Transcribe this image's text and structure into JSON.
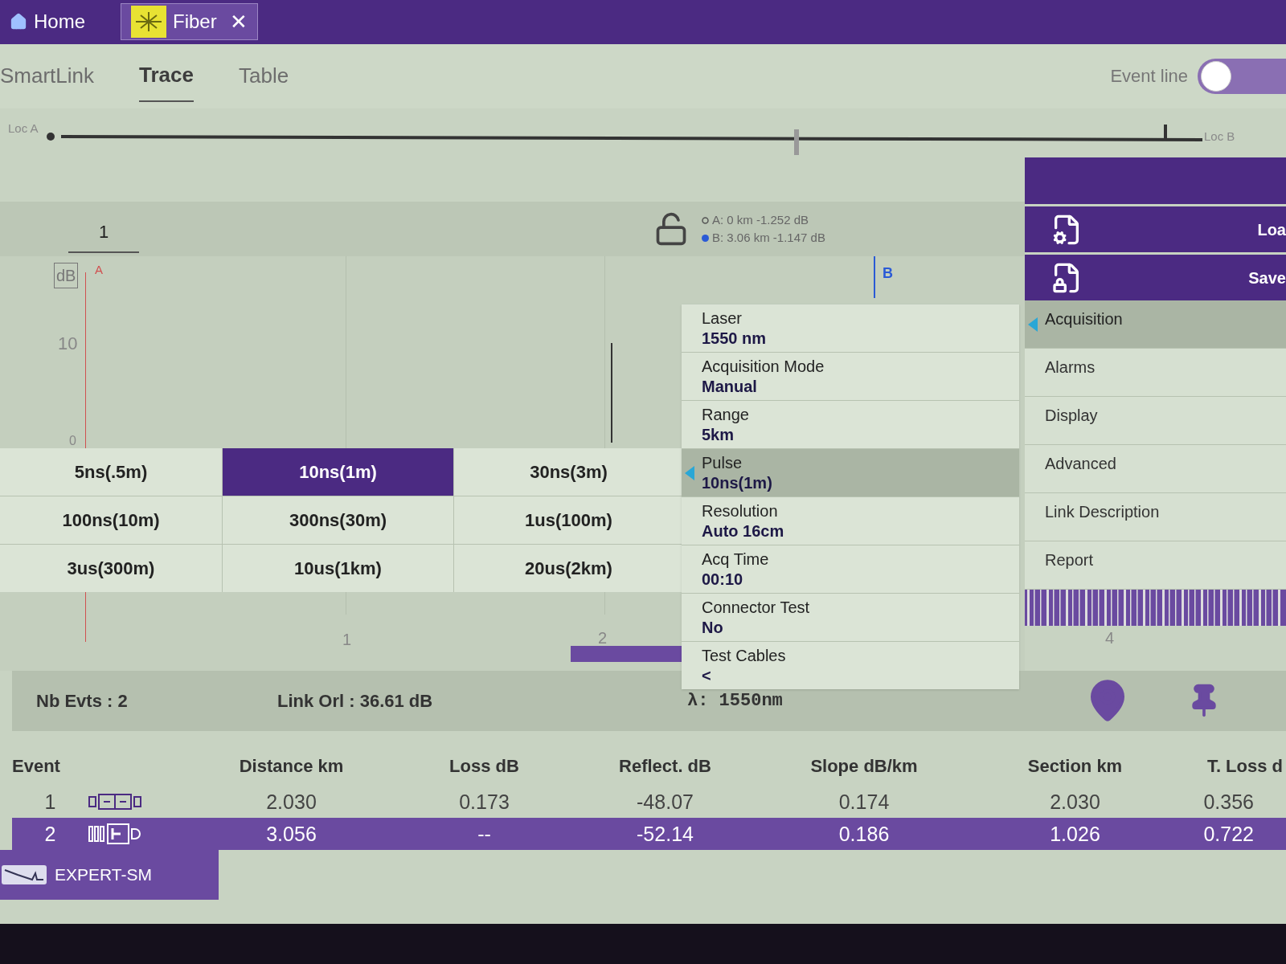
{
  "top_tabs": [
    {
      "label": "Home",
      "kind": "home",
      "selected": false
    },
    {
      "label": "Fiber",
      "kind": "fiber",
      "selected": true,
      "close": "✕"
    }
  ],
  "sub_tabs": [
    {
      "label": "SmartLink",
      "selected": false
    },
    {
      "label": "Trace",
      "selected": true
    },
    {
      "label": "Table",
      "selected": false
    }
  ],
  "event_line": {
    "label": "Event line",
    "on": false
  },
  "locator": {
    "start": "Loc A",
    "end": "Loc B"
  },
  "trace": {
    "tab": "1",
    "cursor_a": "A: 0 km -1.252 dB",
    "cursor_b": "B: 3.06 km -1.147 dB",
    "y_unit": "dB",
    "marker_a": "A",
    "marker_b": "B",
    "y_labels": [
      "10",
      "0"
    ],
    "x_labels": [
      "1",
      "2",
      "4"
    ]
  },
  "pulse_options": [
    {
      "label": "5ns(.5m)",
      "selected": false
    },
    {
      "label": "10ns(1m)",
      "selected": true
    },
    {
      "label": "30ns(3m)",
      "selected": false
    },
    {
      "label": "100ns(10m)",
      "selected": false
    },
    {
      "label": "300ns(30m)",
      "selected": false
    },
    {
      "label": "1us(100m)",
      "selected": false
    },
    {
      "label": "3us(300m)",
      "selected": false
    },
    {
      "label": "10us(1km)",
      "selected": false
    },
    {
      "label": "20us(2km)",
      "selected": false
    }
  ],
  "params": [
    {
      "label": "Laser",
      "value": "1550 nm",
      "selected": false
    },
    {
      "label": "Acquisition Mode",
      "value": "Manual",
      "selected": false
    },
    {
      "label": "Range",
      "value": "5km",
      "selected": false
    },
    {
      "label": "Pulse",
      "value": "10ns(1m)",
      "selected": true
    },
    {
      "label": "Resolution",
      "value": "Auto 16cm",
      "selected": false
    },
    {
      "label": "Acq Time",
      "value": "00:10",
      "selected": false
    },
    {
      "label": "Connector Test",
      "value": "No",
      "selected": false
    },
    {
      "label": "Test Cables",
      "value": "<",
      "selected": false
    }
  ],
  "side_buttons": [
    {
      "label": "Loa",
      "kind": "load"
    },
    {
      "label": "Save",
      "kind": "save"
    }
  ],
  "side_menu": [
    {
      "label": "Acquisition",
      "selected": true
    },
    {
      "label": "Alarms",
      "selected": false
    },
    {
      "label": "Display",
      "selected": false
    },
    {
      "label": "Advanced",
      "selected": false
    },
    {
      "label": "Link Description",
      "selected": false
    },
    {
      "label": "Report",
      "selected": false
    }
  ],
  "summary": {
    "events": "Nb Evts : 2",
    "orl": "Link Orl :  36.61 dB",
    "wavelength": "λ:  1550nm"
  },
  "table": {
    "columns": [
      "Event",
      "Distance  km",
      "Loss dB",
      "Reflect. dB",
      "Slope  dB/km",
      "Section km",
      "T. Loss d"
    ],
    "rows": [
      {
        "cells": [
          "1",
          "2.030",
          "0.173",
          "-48.07",
          "0.174",
          "2.030",
          "0.356"
        ],
        "kind": "splice",
        "selected": false
      },
      {
        "cells": [
          "2",
          "3.056",
          "--",
          "-52.14",
          "0.186",
          "1.026",
          "0.722"
        ],
        "kind": "end",
        "selected": true
      }
    ]
  },
  "mode_button": "EXPERT-SM"
}
